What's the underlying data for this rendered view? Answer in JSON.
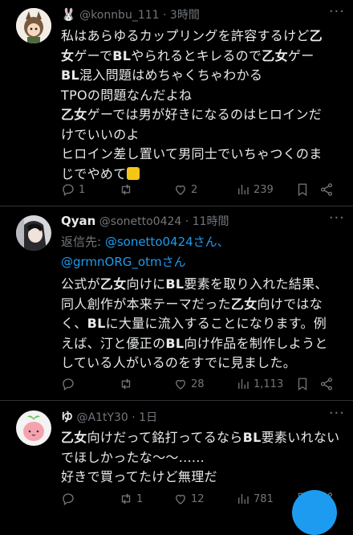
{
  "tweets": [
    {
      "name": "🐰",
      "handle": "@konnbu_111",
      "sep": "·",
      "time": "3時間",
      "lines": [
        [
          {
            "t": "私はあらゆるカップリングを許容するけど"
          },
          {
            "t": "乙",
            "b": true
          }
        ],
        [
          {
            "t": "女",
            "b": true
          },
          {
            "t": "ゲーで"
          },
          {
            "t": "BL",
            "b": true
          },
          {
            "t": "やられるとキレるので"
          },
          {
            "t": "乙女",
            "b": true
          },
          {
            "t": "ゲー"
          }
        ],
        [
          {
            "t": "BL",
            "b": true
          },
          {
            "t": "混入問題はめちゃくちゃわかる"
          }
        ],
        [
          {
            "t": "TPOの問題なんだよね"
          }
        ],
        [
          {
            "t": "乙女",
            "b": true
          },
          {
            "t": "ゲーでは男が好きになるのはヒロインだ"
          }
        ],
        [
          {
            "t": "けでいいのよ"
          }
        ],
        [
          {
            "t": "ヒロイン差し置いて男同士でいちゃつくのま"
          }
        ],
        [
          {
            "t": "じでやめて"
          }
        ]
      ],
      "emoji": "hand-emoji",
      "replies": "1",
      "retweets": "",
      "likes": "2",
      "views": "239"
    },
    {
      "name": "Qyan",
      "handle": "@sonetto0424",
      "sep": "·",
      "time": "11時間",
      "reply_prefix": "返信先: ",
      "reply_link1": "@sonetto0424さん、",
      "reply_link2": "@grmnORG_otmさん",
      "lines": [
        [
          {
            "t": "公式が"
          },
          {
            "t": "乙女",
            "b": true
          },
          {
            "t": "向けに"
          },
          {
            "t": "BL",
            "b": true
          },
          {
            "t": "要素を取り入れた結果、"
          }
        ],
        [
          {
            "t": "同人創作が本来テーマだった"
          },
          {
            "t": "乙女",
            "b": true
          },
          {
            "t": "向けではな"
          }
        ],
        [
          {
            "t": "く、"
          },
          {
            "t": "BL",
            "b": true
          },
          {
            "t": "に大量に流入することになります。例"
          }
        ],
        [
          {
            "t": "えば、汀と優正の"
          },
          {
            "t": "BL",
            "b": true
          },
          {
            "t": "向け作品を制作しようと"
          }
        ],
        [
          {
            "t": "している人がいるのをすでに見ました。"
          }
        ]
      ],
      "replies": "",
      "retweets": "",
      "likes": "28",
      "views": "1,113"
    },
    {
      "name": "ゆ",
      "handle": "@A1tY30",
      "sep": "·",
      "time": "1日",
      "lines": [
        [
          {
            "t": "乙女",
            "b": true
          },
          {
            "t": "向けだって銘打ってるなら"
          },
          {
            "t": "BL",
            "b": true
          },
          {
            "t": "要素いれない"
          }
        ],
        [
          {
            "t": "でほしかったな～～......"
          }
        ],
        [
          {
            "t": "好きで買ってたけど無理だ"
          }
        ]
      ],
      "replies": "",
      "retweets": "1",
      "likes": "12",
      "views": "781"
    }
  ],
  "icons": [
    "reply-icon",
    "retweet-icon",
    "like-icon",
    "views-icon",
    "bookmark-icon",
    "share-icon",
    "more-icon"
  ],
  "colors": {
    "background": "#000000",
    "text": "#e7e9ea",
    "muted": "#71767b",
    "link": "#1d9bf0"
  }
}
